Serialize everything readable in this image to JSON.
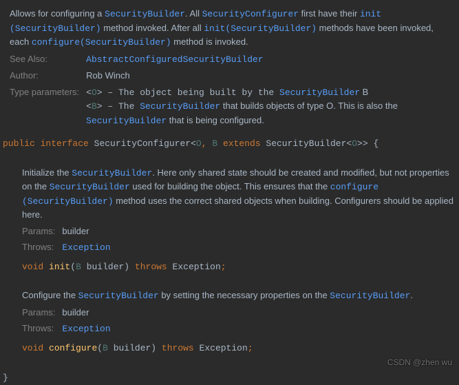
{
  "class_doc": {
    "p1_a": "Allows for configuring a ",
    "p1_b": "SecurityBuilder",
    "p1_c": ". All ",
    "p1_d": "SecurityConfigurer",
    "p1_e": " first have their ",
    "p1_f": "init (SecurityBuilder)",
    "p1_g": " method invoked. After all ",
    "p1_h": "init(SecurityBuilder)",
    "p1_i": " methods have been invoked, each ",
    "p1_j": "configure(SecurityBuilder)",
    "p1_k": " method is invoked.",
    "see_also_label": "See Also:",
    "see_also_val": "AbstractConfiguredSecurityBuilder",
    "author_label": "Author:",
    "author_val": "Rob Winch",
    "type_params_label": "Type parameters:",
    "tp1_a": "<",
    "tp1_b": "O",
    "tp1_c": "> – The object being built by the ",
    "tp1_d": "SecurityBuilder",
    "tp1_e": " B",
    "tp2_a": "<",
    "tp2_b": "B",
    "tp2_c": "> – The ",
    "tp2_d": "SecurityBuilder",
    "tp2_e": " that builds objects of type O. This is also the ",
    "tp2_f": "SecurityBuilder",
    "tp2_g": " that is being configured."
  },
  "class_sig": {
    "public": "public",
    "interface": "interface",
    "name": "SecurityConfigurer",
    "lt1": "<",
    "o": "O",
    "comma": ",",
    "b": "B",
    "extends": "extends",
    "sb": "SecurityBuilder",
    "lt2": "<",
    "o2": "O",
    "gt2": ">>",
    "brace": "{"
  },
  "init_doc": {
    "p_a": "Initialize the ",
    "p_b": "SecurityBuilder",
    "p_c": ". Here only shared state should be created and modified, but not properties on the ",
    "p_d": "SecurityBuilder",
    "p_e": " used for building the object. This ensures that the ",
    "p_f": "configure (SecurityBuilder)",
    "p_g": " method uses the correct shared objects when building. Configurers should be applied here.",
    "params_label": "Params:",
    "params_val": "builder",
    "throws_label": "Throws:",
    "throws_val": "Exception"
  },
  "init_sig": {
    "void": "void",
    "name": "init",
    "lp": "(",
    "b": "B",
    "param": "builder",
    "rp": ")",
    "throws": "throws",
    "exc": "Exception",
    "semi": ";"
  },
  "conf_doc": {
    "p_a": "Configure the ",
    "p_b": "SecurityBuilder",
    "p_c": " by setting the necessary properties on the ",
    "p_d": "SecurityBuilder",
    "p_e": ".",
    "params_label": "Params:",
    "params_val": "builder",
    "throws_label": "Throws:",
    "throws_val": "Exception"
  },
  "conf_sig": {
    "void": "void",
    "name": "configure",
    "lp": "(",
    "b": "B",
    "param": "builder",
    "rp": ")",
    "throws": "throws",
    "exc": "Exception",
    "semi": ";"
  },
  "close_brace": "}",
  "watermark": "CSDN @zhen wu"
}
